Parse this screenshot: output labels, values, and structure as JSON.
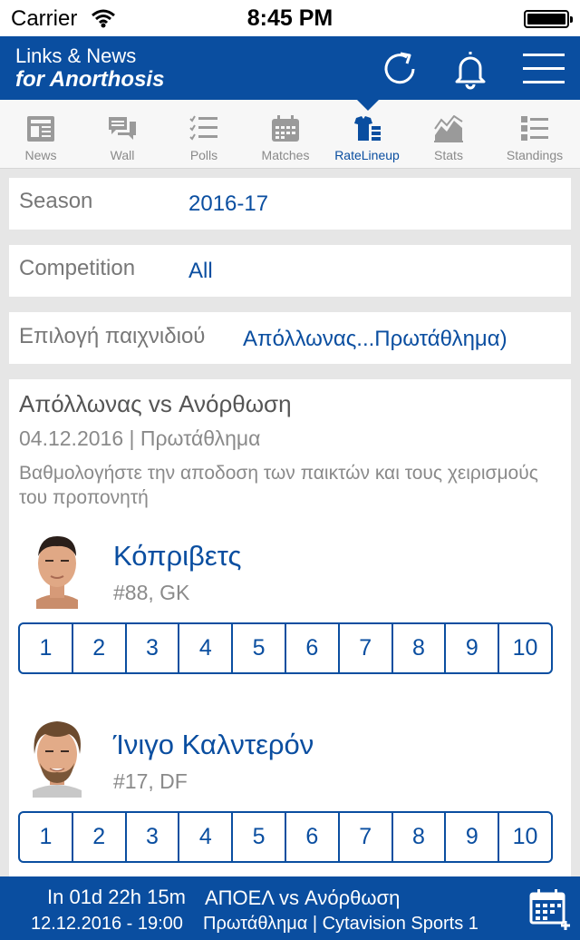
{
  "status_bar": {
    "carrier": "Carrier",
    "time": "8:45 PM"
  },
  "header": {
    "title_line1": "Links & News",
    "title_line2": "for Anorthosis"
  },
  "tabs": [
    {
      "label": "News",
      "icon": "news-icon"
    },
    {
      "label": "Wall",
      "icon": "chat-icon"
    },
    {
      "label": "Polls",
      "icon": "checklist-icon"
    },
    {
      "label": "Matches",
      "icon": "calendar-icon"
    },
    {
      "label": "RateLineup",
      "icon": "lineup-icon"
    },
    {
      "label": "Stats",
      "icon": "chart-icon"
    },
    {
      "label": "Standings",
      "icon": "ranking-icon"
    }
  ],
  "active_tab": "RateLineup",
  "filters": {
    "season_label": "Season",
    "season_value": "2016-17",
    "competition_label": "Competition",
    "competition_value": "All",
    "game_label": "Επιλογή παιχνιδιού",
    "game_value": "Απόλλωνας...Πρωτάθλημα)"
  },
  "match": {
    "title": "Απόλλωνας vs Ανόρθωση",
    "date_line": "04.12.2016 | Πρωτάθλημα",
    "description": "Βαθμολογήστε την αποδοση των παικτών και τους χειρισμούς του προπονητή"
  },
  "players": [
    {
      "name": "Κόπριβετς",
      "info": "#88, GK"
    },
    {
      "name": "Ίνιγο Καλντερόν",
      "info": "#17, DF"
    }
  ],
  "rating_scale": [
    "1",
    "2",
    "3",
    "4",
    "5",
    "6",
    "7",
    "8",
    "9",
    "10"
  ],
  "footer": {
    "countdown": "In 01d 22h 15m",
    "next_match": "ΑΠΟΕΛ vs Ανόρθωση",
    "datetime": "12.12.2016 - 19:00",
    "details": "Πρωτάθλημα | Cytavision Sports 1"
  },
  "colors": {
    "brand_blue": "#0a4ea0",
    "tab_grey": "#8a8a8a"
  }
}
